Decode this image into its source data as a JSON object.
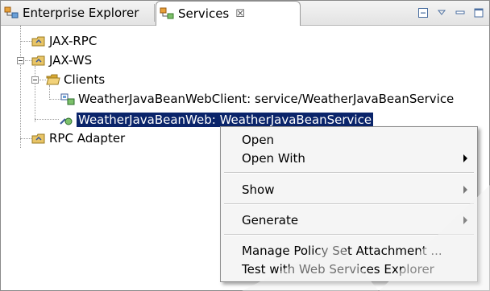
{
  "tabs": {
    "enterprise_explorer": "Enterprise Explorer",
    "services": "Services",
    "close_glyph": "☒"
  },
  "tree": {
    "jax_rpc": "JAX-RPC",
    "jax_ws": "JAX-WS",
    "clients": "Clients",
    "client_item": "WeatherJavaBeanWebClient: service/WeatherJavaBeanService",
    "service_item": "WeatherJavaBeanWeb: WeatherJavaBeanService",
    "rpc_adapter": "RPC Adapter"
  },
  "context_menu": {
    "open": "Open",
    "open_with": "Open With",
    "show": "Show",
    "generate": "Generate",
    "manage_policy": "Manage Policy Set Attachment ...",
    "test_explorer": "Test with Web Services Explorer"
  },
  "colors": {
    "selection": "#0a246a",
    "folder": "#e8c466",
    "tab_bg": "#e3e3e3"
  }
}
